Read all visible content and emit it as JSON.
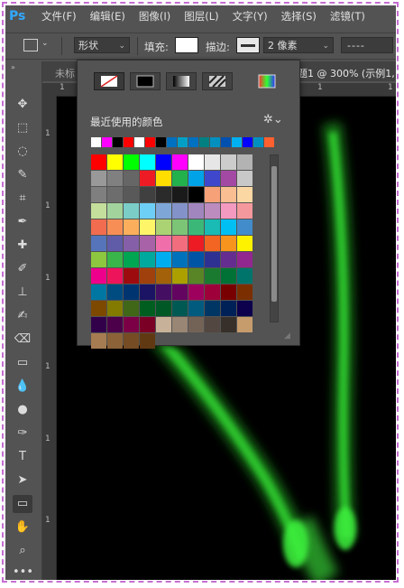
{
  "menubar": {
    "logo": "Ps",
    "items": [
      "文件(F)",
      "编辑(E)",
      "图像(I)",
      "图层(L)",
      "文字(Y)",
      "选择(S)",
      "滤镜(T)"
    ]
  },
  "options": {
    "mode": "形状",
    "fill_label": "填充:",
    "fill_color": "#ffffff",
    "stroke_label": "描边:",
    "stroke_width": "2 像素",
    "stroke_type": "----"
  },
  "tabs": {
    "left": "未标",
    "right": "题1 @ 300% (示例1,"
  },
  "ruler_top": [
    "1",
    "1",
    "1",
    "1",
    "1"
  ],
  "ruler_left": [
    "1",
    "1",
    "1",
    "1",
    "1",
    "1"
  ],
  "popup": {
    "fill_types": [
      "no-color",
      "solid-color",
      "gradient",
      "pattern"
    ],
    "recent_label": "最近使用的颜色",
    "recent_colors": [
      "#ffffff",
      "#ff00ff",
      "#000000",
      "#ff0000",
      "#ffffff",
      "#ff0000",
      "#000000",
      "#0070c0",
      "#00a0c6",
      "#0070c0",
      "#008080",
      "#0090c0",
      "#0050b0",
      "#00b0f0",
      "#0000ff",
      "#0090c0",
      "#ff6030"
    ],
    "swatches": [
      "#ff0000",
      "#ffff00",
      "#00ff00",
      "#00ffff",
      "#0000ff",
      "#ff00ff",
      "#ffffff",
      "#e6e6e6",
      "#cccccc",
      "#b3b3b3",
      "#999999",
      "#808080",
      "#666666",
      "#ed1c24",
      "#ffde00",
      "#22b14c",
      "#00a2e8",
      "#3f48cc",
      "#a349a4",
      "#c8c8c8",
      "#7f7f7f",
      "#6d6d6d",
      "#595959",
      "#404040",
      "#2b2b2b",
      "#1a1a1a",
      "#000000",
      "#f7a179",
      "#f9be91",
      "#fbd7a3",
      "#c4df9b",
      "#a3d39c",
      "#7bcdc8",
      "#6dcff6",
      "#7ea7d8",
      "#8393ca",
      "#a186be",
      "#bd8cbf",
      "#f49ac1",
      "#f5989d",
      "#f26c4f",
      "#f68e56",
      "#fbaf5d",
      "#fff568",
      "#acd373",
      "#7cc576",
      "#3bb878",
      "#1abbb4",
      "#00bff3",
      "#438ccb",
      "#5674b9",
      "#605ca8",
      "#855fa8",
      "#a863a8",
      "#f06eaa",
      "#f26d7d",
      "#ed1c24",
      "#f26522",
      "#f7941d",
      "#fff200",
      "#8dc63f",
      "#39b54a",
      "#00a651",
      "#00a99d",
      "#00aeef",
      "#0072bc",
      "#0054a6",
      "#2e3192",
      "#662d91",
      "#92278f",
      "#ec008c",
      "#ed145b",
      "#9e0b0f",
      "#a0410d",
      "#a36209",
      "#aba000",
      "#598527",
      "#1a7b30",
      "#007236",
      "#00746b",
      "#0076a3",
      "#004b80",
      "#003471",
      "#1b1464",
      "#440e62",
      "#630460",
      "#9e005d",
      "#9e0039",
      "#790000",
      "#7b2e00",
      "#7d4900",
      "#827b00",
      "#406618",
      "#005e20",
      "#005826",
      "#005952",
      "#005b7f",
      "#003663",
      "#002157",
      "#0d004c",
      "#32004b",
      "#4b0049",
      "#7b0046",
      "#7a0026",
      "#c7b299",
      "#998675",
      "#736357",
      "#534741",
      "#37302a",
      "#c69c6d",
      "#a67c52",
      "#8c6239",
      "#754c24",
      "#603913"
    ]
  }
}
